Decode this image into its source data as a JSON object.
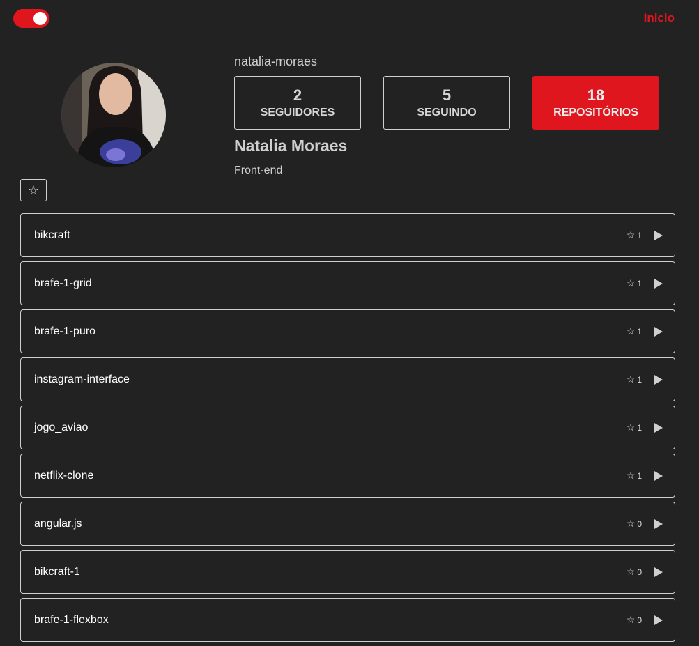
{
  "nav": {
    "home_label": "Inicio",
    "theme_toggle_on": true
  },
  "profile": {
    "username": "natalia-moraes",
    "name": "Natalia Moraes",
    "bio": "Front-end",
    "favorite_icon": "star-outline"
  },
  "stats": {
    "followers": {
      "count": "2",
      "label": "SEGUIDORES"
    },
    "following": {
      "count": "5",
      "label": "SEGUINDO"
    },
    "repos": {
      "count": "18",
      "label": "REPOSITÓRIOS"
    }
  },
  "repositories": [
    {
      "name": "bikcraft",
      "stars": "1"
    },
    {
      "name": "brafe-1-grid",
      "stars": "1"
    },
    {
      "name": "brafe-1-puro",
      "stars": "1"
    },
    {
      "name": "instagram-interface",
      "stars": "1"
    },
    {
      "name": "jogo_aviao",
      "stars": "1"
    },
    {
      "name": "netflix-clone",
      "stars": "1"
    },
    {
      "name": "angular.js",
      "stars": "0"
    },
    {
      "name": "bikcraft-1",
      "stars": "0"
    },
    {
      "name": "brafe-1-flexbox",
      "stars": "0"
    }
  ],
  "colors": {
    "accent": "#e0161f",
    "background": "#222222",
    "border": "#cfcfcf"
  }
}
